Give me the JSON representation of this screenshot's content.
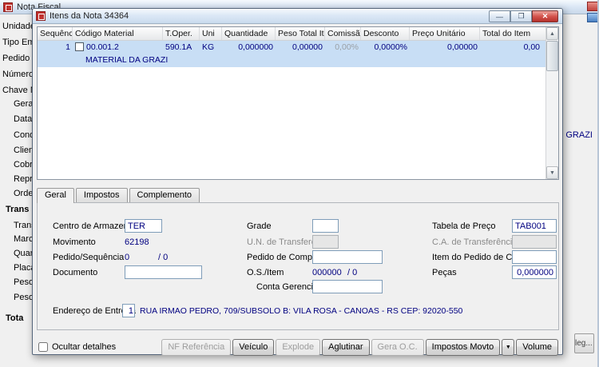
{
  "colors": {
    "value_text": "#000080",
    "selection": "#c8def5",
    "close_button": "#c0392b",
    "titlebar": "#dce8f6"
  },
  "icons": {
    "up_arrow": "▲",
    "down_arrow": "▼",
    "dropdown": "▼",
    "minimize": "—",
    "maximize": "❐",
    "close": "✕"
  },
  "background": {
    "title": "Nota Fiscal",
    "labels": [
      "Unidade",
      "Tipo Emis",
      "Pedido",
      "Número",
      "Chave N",
      "Gera",
      "Data",
      "Condi",
      "Client",
      "Cobra",
      "Repre",
      "Orden",
      "Trans",
      "Transp",
      "Marca",
      "Quant",
      "Placa",
      "Peso",
      "Peso",
      "Tota"
    ],
    "fragment_right": "GRAZI",
    "fragment_bottom": "leg..."
  },
  "dialog": {
    "title": "Itens da Nota 34364",
    "grid": {
      "columns": [
        "Sequência",
        "Código Material",
        "T.Oper.",
        "Uni",
        "Quantidade",
        "Peso Total Item",
        "Comissão",
        "Desconto",
        "Preço Unitário",
        "Total do Item"
      ],
      "rows": [
        {
          "sequencia": "1",
          "codigo": "00.001.2",
          "descricao": "MATERIAL DA GRAZI",
          "t_oper": "590.1A",
          "uni": "KG",
          "quantidade": "0,000000",
          "peso_total_item": "0,00000",
          "comissao": "0,00%",
          "desconto": "0,0000%",
          "preco_unitario": "0,00000",
          "total_do_item": "0,00"
        }
      ]
    },
    "tabs": [
      "Geral",
      "Impostos",
      "Complemento"
    ],
    "form": {
      "centro_armazenagem": {
        "label": "Centro de Armazenagem",
        "value": "TER"
      },
      "grade": {
        "label": "Grade",
        "value": ""
      },
      "tabela_preco": {
        "label": "Tabela de Preço",
        "value": "TAB001"
      },
      "movimento": {
        "label": "Movimento",
        "value": "62198"
      },
      "un_transferencia": {
        "label": "U.N. de Transferência",
        "value": ""
      },
      "ca_transferencia": {
        "label": "C.A. de Transferência",
        "value": ""
      },
      "pedido_sequencia": {
        "label": "Pedido/Sequência",
        "value1": "0",
        "sep": "/  0"
      },
      "pedido_compra": {
        "label": "Pedido de Compra",
        "value": ""
      },
      "item_pedido_compra": {
        "label": "Item do Pedido de Compra",
        "value": ""
      },
      "documento": {
        "label": "Documento",
        "value": ""
      },
      "os_item": {
        "label": "O.S./Item",
        "value1": "000000",
        "sep": "/  0"
      },
      "pecas": {
        "label": "Peças",
        "value": "0,000000"
      },
      "conta_gerencial": {
        "label": "Conta Gerencial",
        "value": ""
      },
      "endereco_entrega": {
        "label": "Endereço de Entrega",
        "number": "1",
        "address": "RUA IRMAO PEDRO, 709/SUBSOLO B: VILA ROSA - CANOAS - RS CEP: 92020-550"
      }
    },
    "footer": {
      "ocultar_detalhes": "Ocultar detalhes",
      "buttons": [
        {
          "label": "NF Referência",
          "enabled": false
        },
        {
          "label": "Veículo",
          "enabled": true
        },
        {
          "label": "Explode",
          "enabled": false
        },
        {
          "label": "Aglutinar",
          "enabled": true
        },
        {
          "label": "Gera O.C.",
          "enabled": false
        },
        {
          "label": "Impostos Movto",
          "enabled": true
        },
        {
          "label": "Volume",
          "enabled": true
        }
      ]
    }
  }
}
